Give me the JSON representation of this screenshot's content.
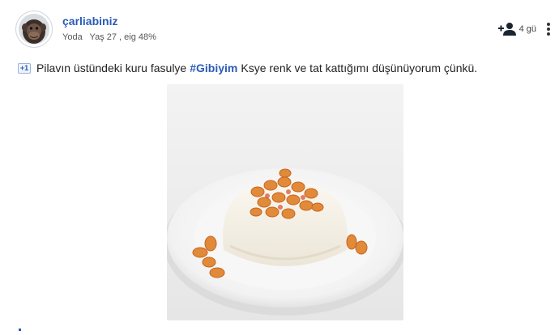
{
  "post": {
    "username": "çarliabiniz",
    "meta": {
      "rank": "Yoda",
      "age": "Yaş 27 , eig 48%"
    },
    "time": "4 gü",
    "text": {
      "badge": "+1",
      "before": "Pilavın üstündeki kuru fasulye",
      "hashtag": "#Gibiyim",
      "after": "Ksye renk ve tat kattığımı düşünüyorum çünkü."
    }
  },
  "icons": {
    "avatar": "chimp-avatar",
    "add_friend": "add-person-icon",
    "more": "vertical-ellipsis-icon",
    "photo": "rice-with-beans-photo"
  },
  "colors": {
    "link": "#2a5bb7",
    "text": "#222222",
    "meta": "#555555"
  }
}
